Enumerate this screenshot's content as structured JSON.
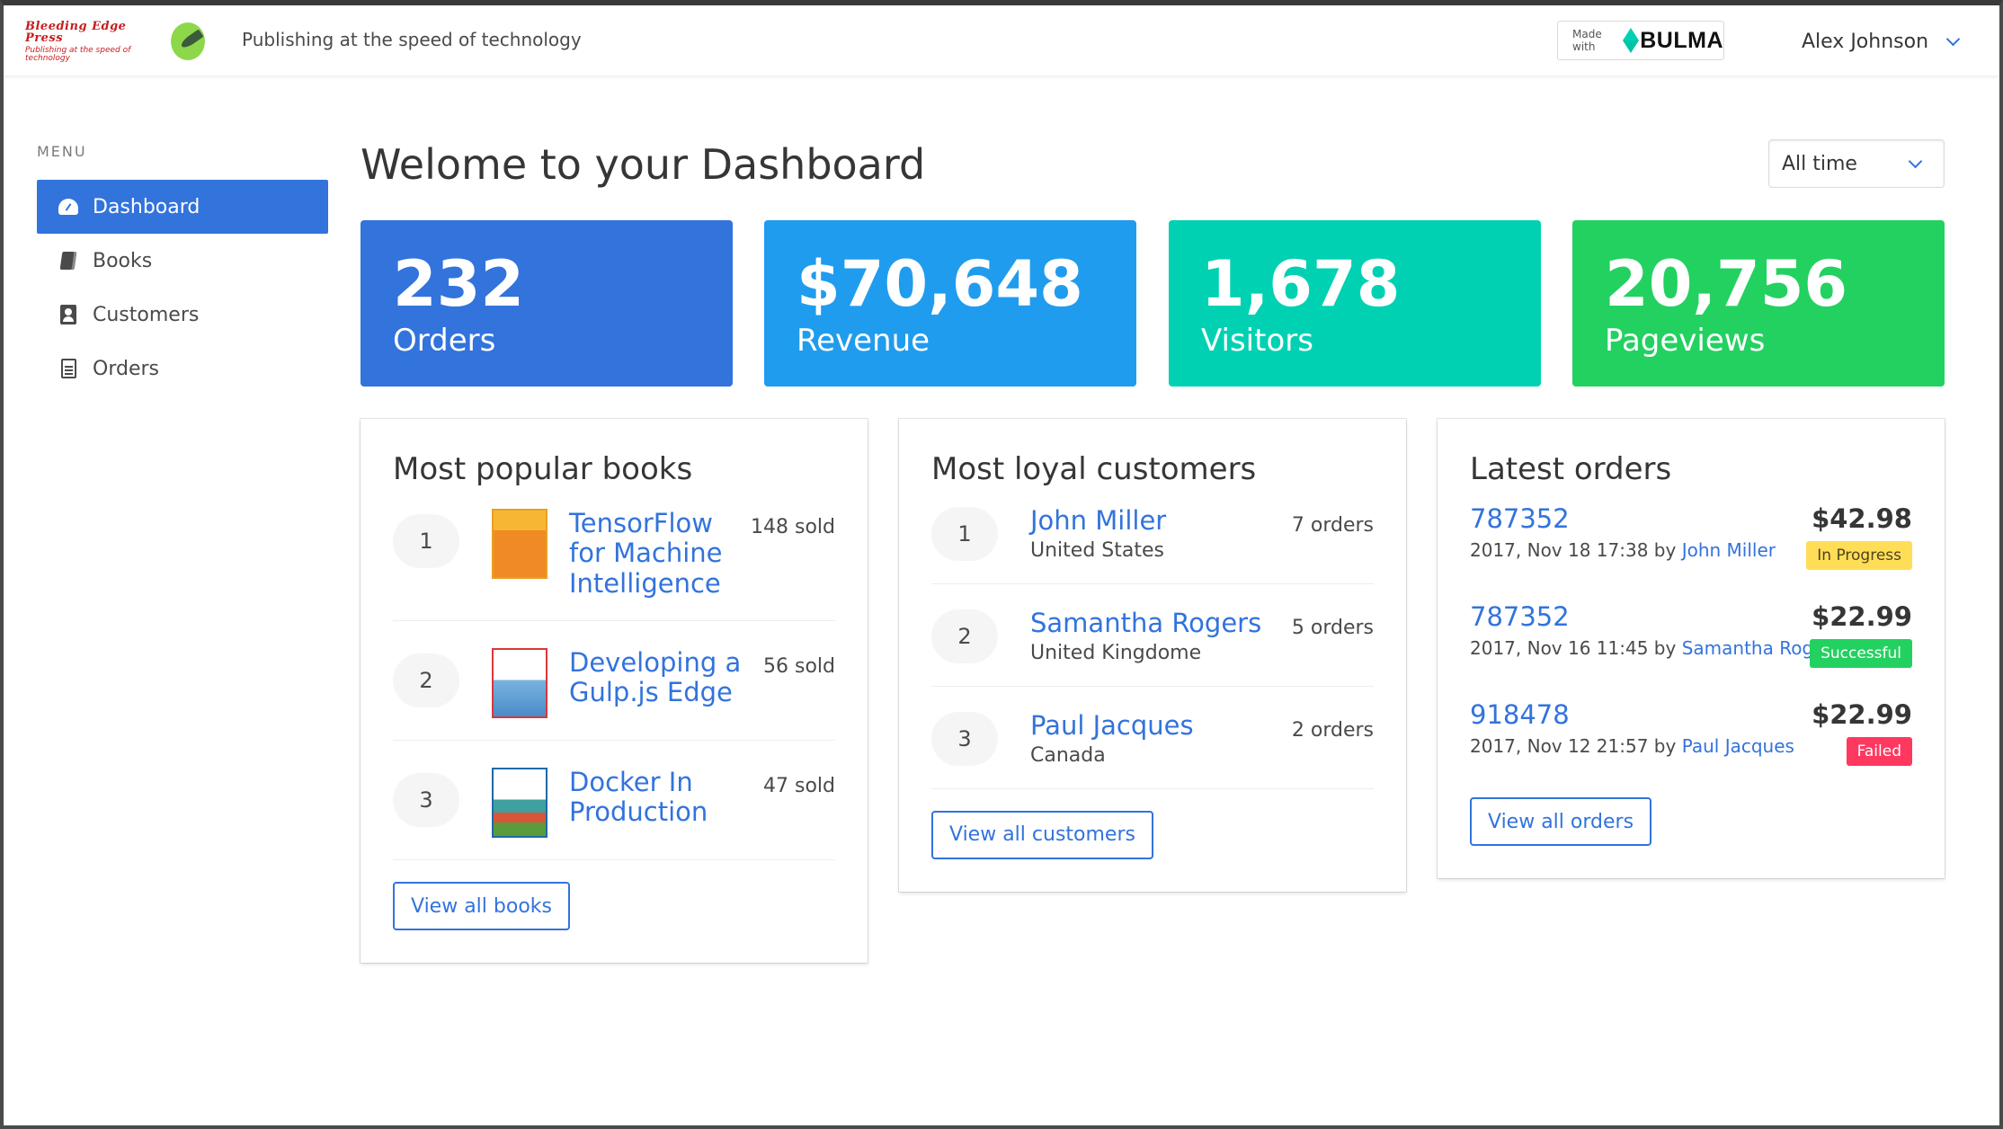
{
  "navbar": {
    "brand_name": "Bleeding Edge Press",
    "brand_subtitle": "Publishing at the speed of technology",
    "tagline": "Publishing at the speed of technology",
    "made_with_label": "Made with",
    "made_with_brand": "BULMA",
    "user_name": "Alex Johnson"
  },
  "sidebar": {
    "label": "MENU",
    "items": [
      {
        "label": "Dashboard",
        "icon": "dashboard-icon",
        "active": true
      },
      {
        "label": "Books",
        "icon": "book-icon"
      },
      {
        "label": "Customers",
        "icon": "contact-icon"
      },
      {
        "label": "Orders",
        "icon": "file-text-icon"
      }
    ]
  },
  "main": {
    "title": "Welome to your Dashboard",
    "range_select": {
      "selected": "All time"
    },
    "stats": [
      {
        "value": "232",
        "label": "Orders",
        "color": "#3273dc"
      },
      {
        "value": "$70,648",
        "label": "Revenue",
        "color": "#209cee"
      },
      {
        "value": "1,678",
        "label": "Visitors",
        "color": "#00d1b2"
      },
      {
        "value": "20,756",
        "label": "Pageviews",
        "color": "#23d160"
      }
    ]
  },
  "popular_books": {
    "title": "Most popular books",
    "items": [
      {
        "rank": "1",
        "title": "TensorFlow for Machine Intelligence",
        "sold": "148 sold"
      },
      {
        "rank": "2",
        "title": "Developing a Gulp.js Edge",
        "sold": "56 sold"
      },
      {
        "rank": "3",
        "title": "Docker In Production",
        "sold": "47 sold"
      }
    ],
    "button": "View all books"
  },
  "loyal_customers": {
    "title": "Most loyal customers",
    "items": [
      {
        "rank": "1",
        "name": "John Miller",
        "country": "United States",
        "orders": "7 orders"
      },
      {
        "rank": "2",
        "name": "Samantha Rogers",
        "country": "United Kingdome",
        "orders": "5 orders"
      },
      {
        "rank": "3",
        "name": "Paul Jacques",
        "country": "Canada",
        "orders": "2 orders"
      }
    ],
    "button": "View all customers"
  },
  "latest_orders": {
    "title": "Latest orders",
    "items": [
      {
        "id": "787352",
        "date": "2017, Nov 18 17:38 by",
        "customer": "John Miller",
        "amount": "$42.98",
        "status": "In Progress",
        "status_color": "#ffdd57"
      },
      {
        "id": "787352",
        "date": "2017, Nov 16 11:45 by",
        "customer": "Samantha Rogers",
        "amount": "$22.99",
        "status": "Successful",
        "status_color": "#23d160"
      },
      {
        "id": "918478",
        "date": "2017, Nov 12 21:57 by",
        "customer": "Paul Jacques",
        "amount": "$22.99",
        "status": "Failed",
        "status_color": "#ff3860"
      }
    ],
    "button": "View all orders"
  }
}
